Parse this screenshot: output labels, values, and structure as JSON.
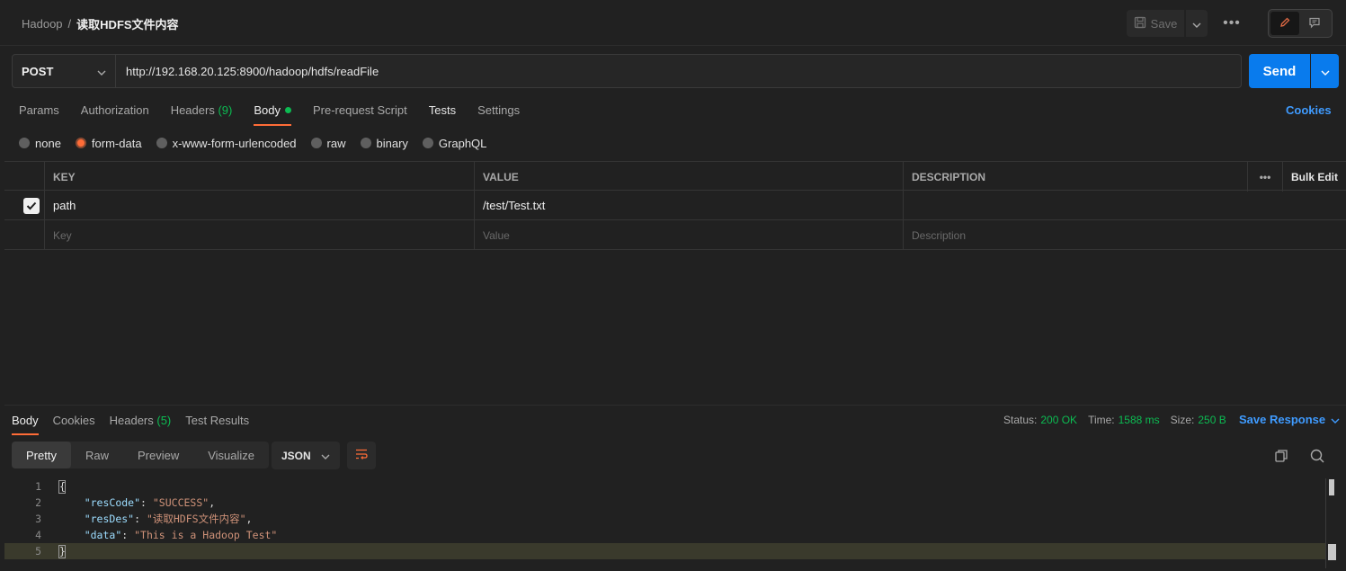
{
  "header": {
    "breadcrumb_parent": "Hadoop",
    "breadcrumb_sep": "/",
    "breadcrumb_current": "读取HDFS文件内容",
    "save_label": "Save"
  },
  "request": {
    "method": "POST",
    "url": "http://192.168.20.125:8900/hadoop/hdfs/readFile",
    "send_label": "Send",
    "cookies_label": "Cookies"
  },
  "request_tabs": [
    {
      "label": "Params"
    },
    {
      "label": "Authorization"
    },
    {
      "label": "Headers",
      "count": "(9)"
    },
    {
      "label": "Body"
    },
    {
      "label": "Pre-request Script"
    },
    {
      "label": "Tests"
    },
    {
      "label": "Settings"
    }
  ],
  "body_types": [
    {
      "label": "none",
      "selected": false
    },
    {
      "label": "form-data",
      "selected": true
    },
    {
      "label": "x-www-form-urlencoded",
      "selected": false
    },
    {
      "label": "raw",
      "selected": false
    },
    {
      "label": "binary",
      "selected": false
    },
    {
      "label": "GraphQL",
      "selected": false
    }
  ],
  "params_table": {
    "headers": {
      "key": "KEY",
      "value": "VALUE",
      "description": "DESCRIPTION",
      "bulk_edit": "Bulk Edit"
    },
    "rows": [
      {
        "checked": true,
        "key": "path",
        "value": "/test/Test.txt",
        "description": ""
      }
    ],
    "placeholders": {
      "key": "Key",
      "value": "Value",
      "description": "Description"
    }
  },
  "response": {
    "tabs": [
      {
        "label": "Body"
      },
      {
        "label": "Cookies"
      },
      {
        "label": "Headers",
        "count": "(5)"
      },
      {
        "label": "Test Results"
      }
    ],
    "status_label": "Status:",
    "status_value": "200 OK",
    "time_label": "Time:",
    "time_value": "1588 ms",
    "size_label": "Size:",
    "size_value": "250 B",
    "save_response_label": "Save Response",
    "view_tabs": [
      "Pretty",
      "Raw",
      "Preview",
      "Visualize"
    ],
    "format": "JSON",
    "code_lines": [
      {
        "num": "1",
        "text": "{"
      },
      {
        "num": "2",
        "key": "\"resCode\"",
        "value": "\"SUCCESS\"",
        "trail": ","
      },
      {
        "num": "3",
        "key": "\"resDes\"",
        "value": "\"读取HDFS文件内容\"",
        "trail": ","
      },
      {
        "num": "4",
        "key": "\"data\"",
        "value": "\"This is a Hadoop Test\"",
        "trail": ""
      },
      {
        "num": "5",
        "text": "}"
      }
    ]
  },
  "colors": {
    "accent_orange": "#ff6c37",
    "send_blue": "#097bed",
    "link_blue": "#3f9bff",
    "status_green": "#0cbb52"
  }
}
